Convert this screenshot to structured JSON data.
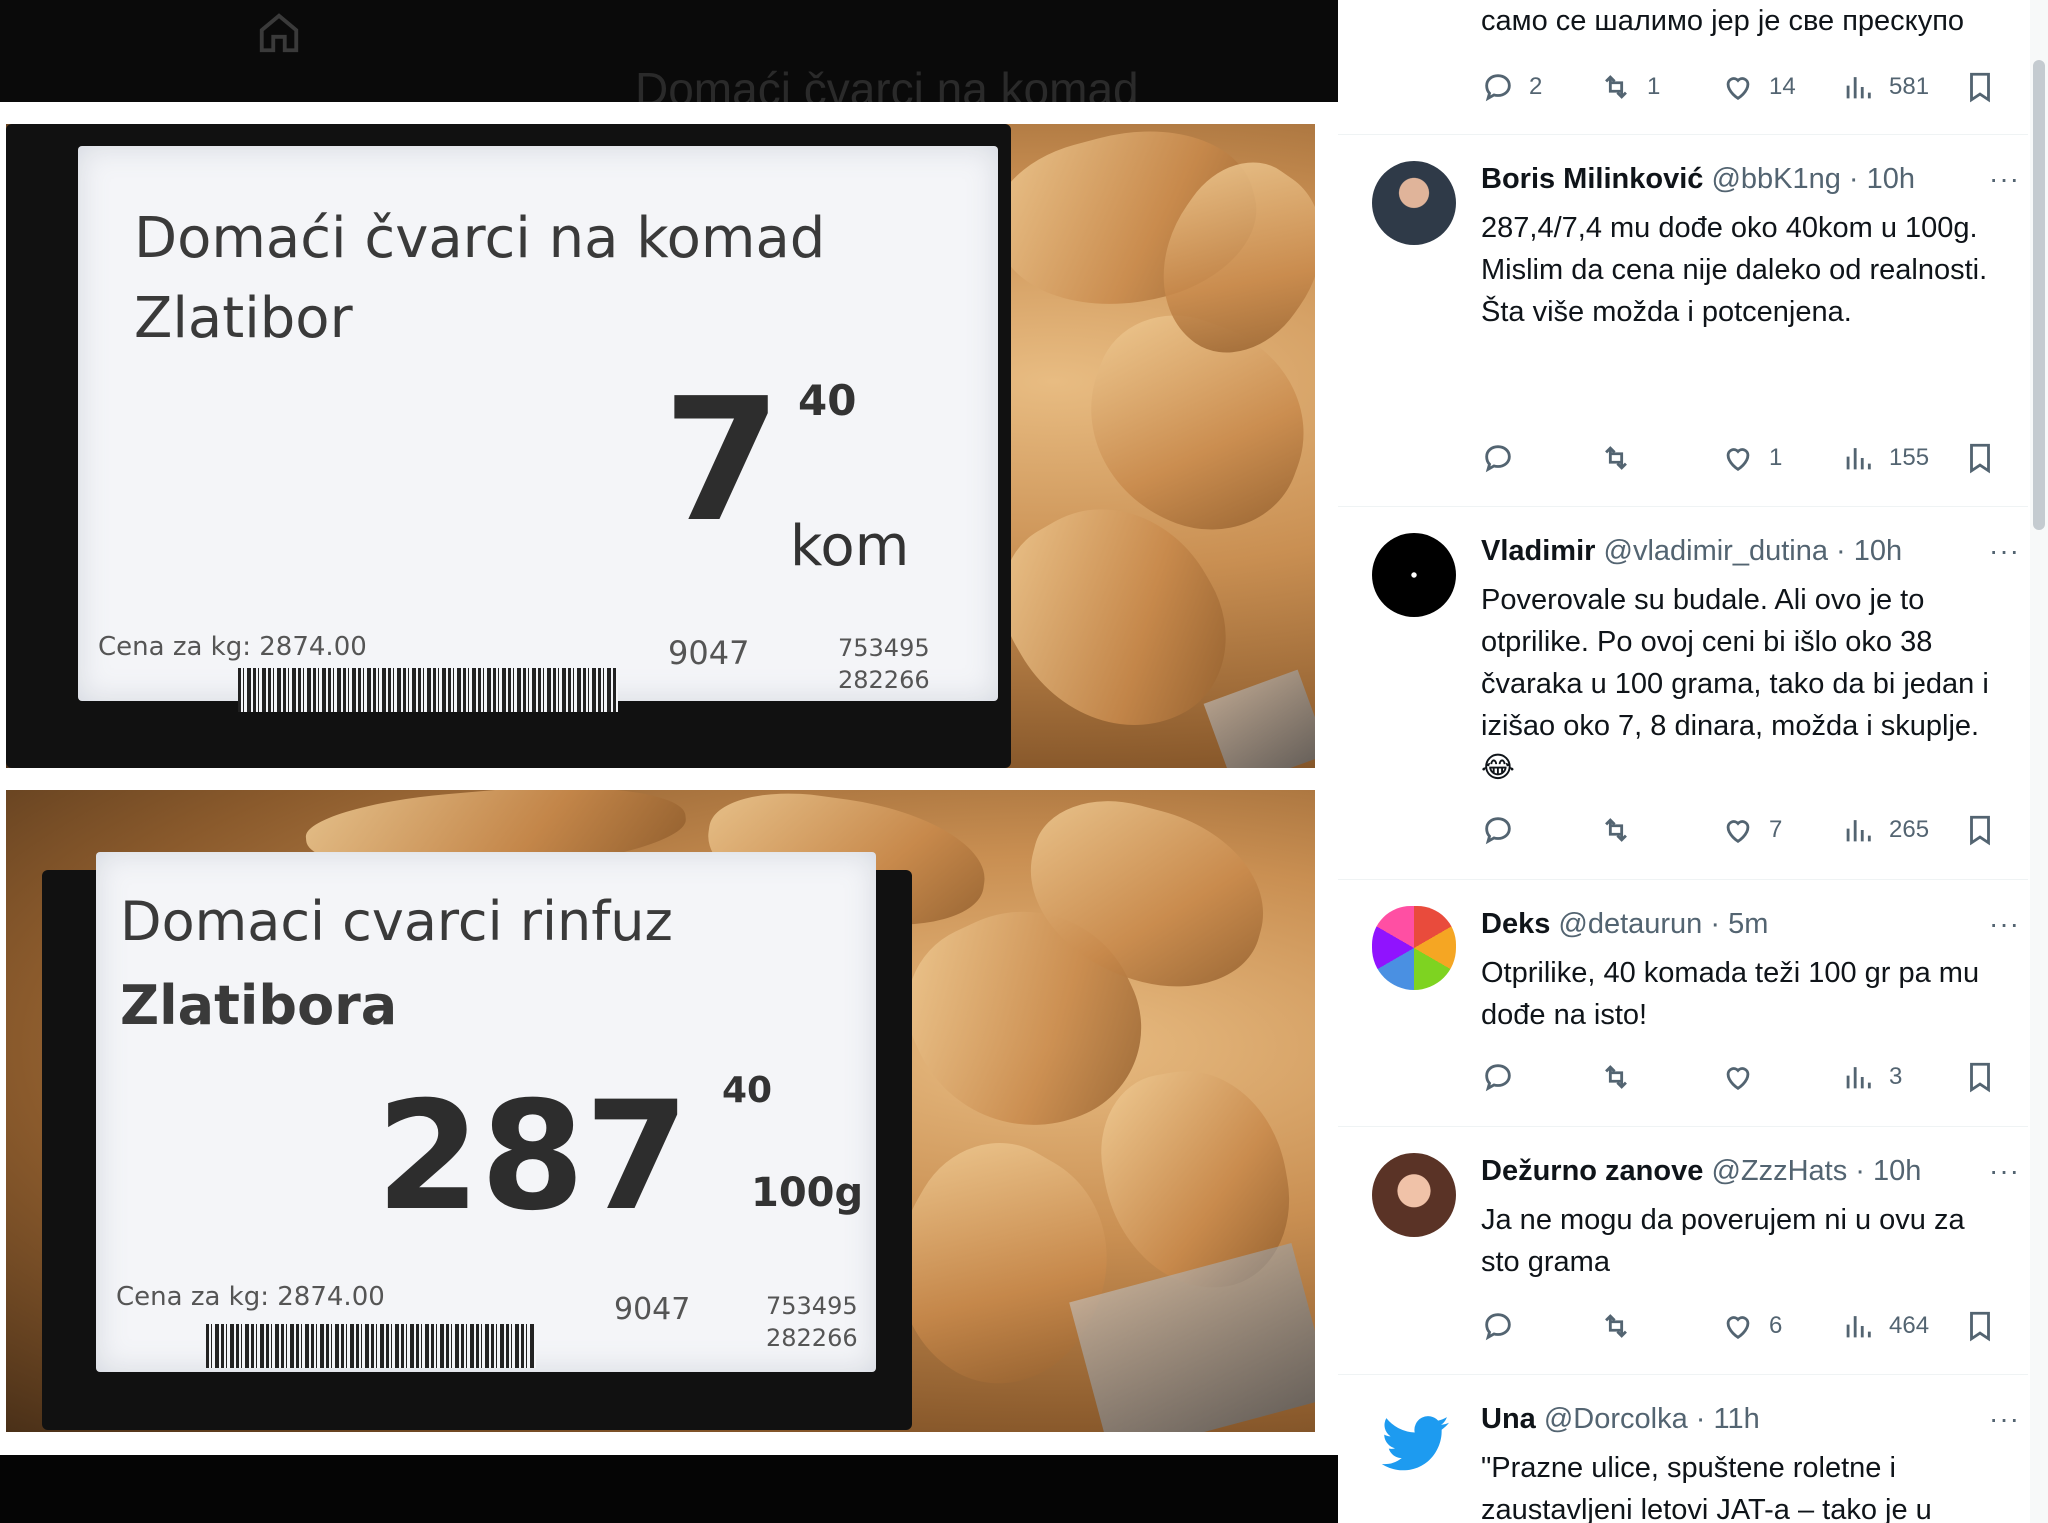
{
  "viewer": {
    "ghost_title": "Domaći čvarci na komad",
    "label1": {
      "title_line1": "Domaći čvarci na komad",
      "title_line2": "Zlatibor",
      "price": "7",
      "price_sup": "40",
      "unit": "kom",
      "kg_price": "Cena za kg: 2874.00",
      "code": "9047",
      "code2": "753495",
      "code3": "282266"
    },
    "label2": {
      "title_line1": "Domaci cvarci rinfuz",
      "title_line2": "Zlatibora",
      "price": "287",
      "price_sup": "40",
      "unit": "100g",
      "kg_price": "Cena za kg: 2874.00",
      "code": "9047",
      "code2": "753495",
      "code3": "282266"
    }
  },
  "replies": [
    {
      "text": "само се шалимо јер је све прескупо",
      "replies": "2",
      "reposts": "1",
      "likes": "14",
      "views": "581"
    },
    {
      "name": "Boris Milinković",
      "handle": "@bbK1ng · 10h",
      "more": "···",
      "text": "287,4/7,4 mu dođe oko 40kom u 100g.\nMislim da cena nije daleko od realnosti. Šta više možda i potcenjena.",
      "replies": "",
      "reposts": "",
      "likes": "1",
      "views": "155",
      "avatar_color": "#6b7a8a"
    },
    {
      "name": "Vladimir",
      "handle": "@vladimir_dutina · 10h",
      "more": "···",
      "text": "Poverovale su budale. Ali ovo je to otprilike. Po ovoj ceni bi išlo oko 38 čvaraka u 100 grama, tako da bi jedan i izišao oko 7, 8 dinara, možda i skuplje. 😂",
      "replies": "",
      "reposts": "",
      "likes": "7",
      "views": "265",
      "avatar_color": "#000000"
    },
    {
      "name": "Deks",
      "handle": "@detaurun · 5m",
      "more": "···",
      "text": "Otprilike, 40 komada teži 100 gr pa mu dođe na isto!",
      "replies": "",
      "reposts": "",
      "likes": "",
      "views": "3",
      "avatar_color": "#ffffff"
    },
    {
      "name": "Dežurno zanove",
      "handle": "@ZzzHats · 10h",
      "more": "···",
      "text": "Ja ne mogu da poverujem ni u ovu za sto grama",
      "replies": "",
      "reposts": "",
      "likes": "6",
      "views": "464",
      "avatar_color": "#7a4a3a"
    },
    {
      "name": "Una",
      "handle": "@Dorcolka · 11h",
      "more": "···",
      "text": "\"Prazne ulice, spuštene roletne i zaustavljeni letovi JAT-a – tako je u",
      "avatar_color": "#ffffff"
    }
  ],
  "colors": {
    "text": "#0f1419",
    "muted": "#536471",
    "divider": "#eff3f4",
    "twitter_blue": "#1d9bf0"
  }
}
